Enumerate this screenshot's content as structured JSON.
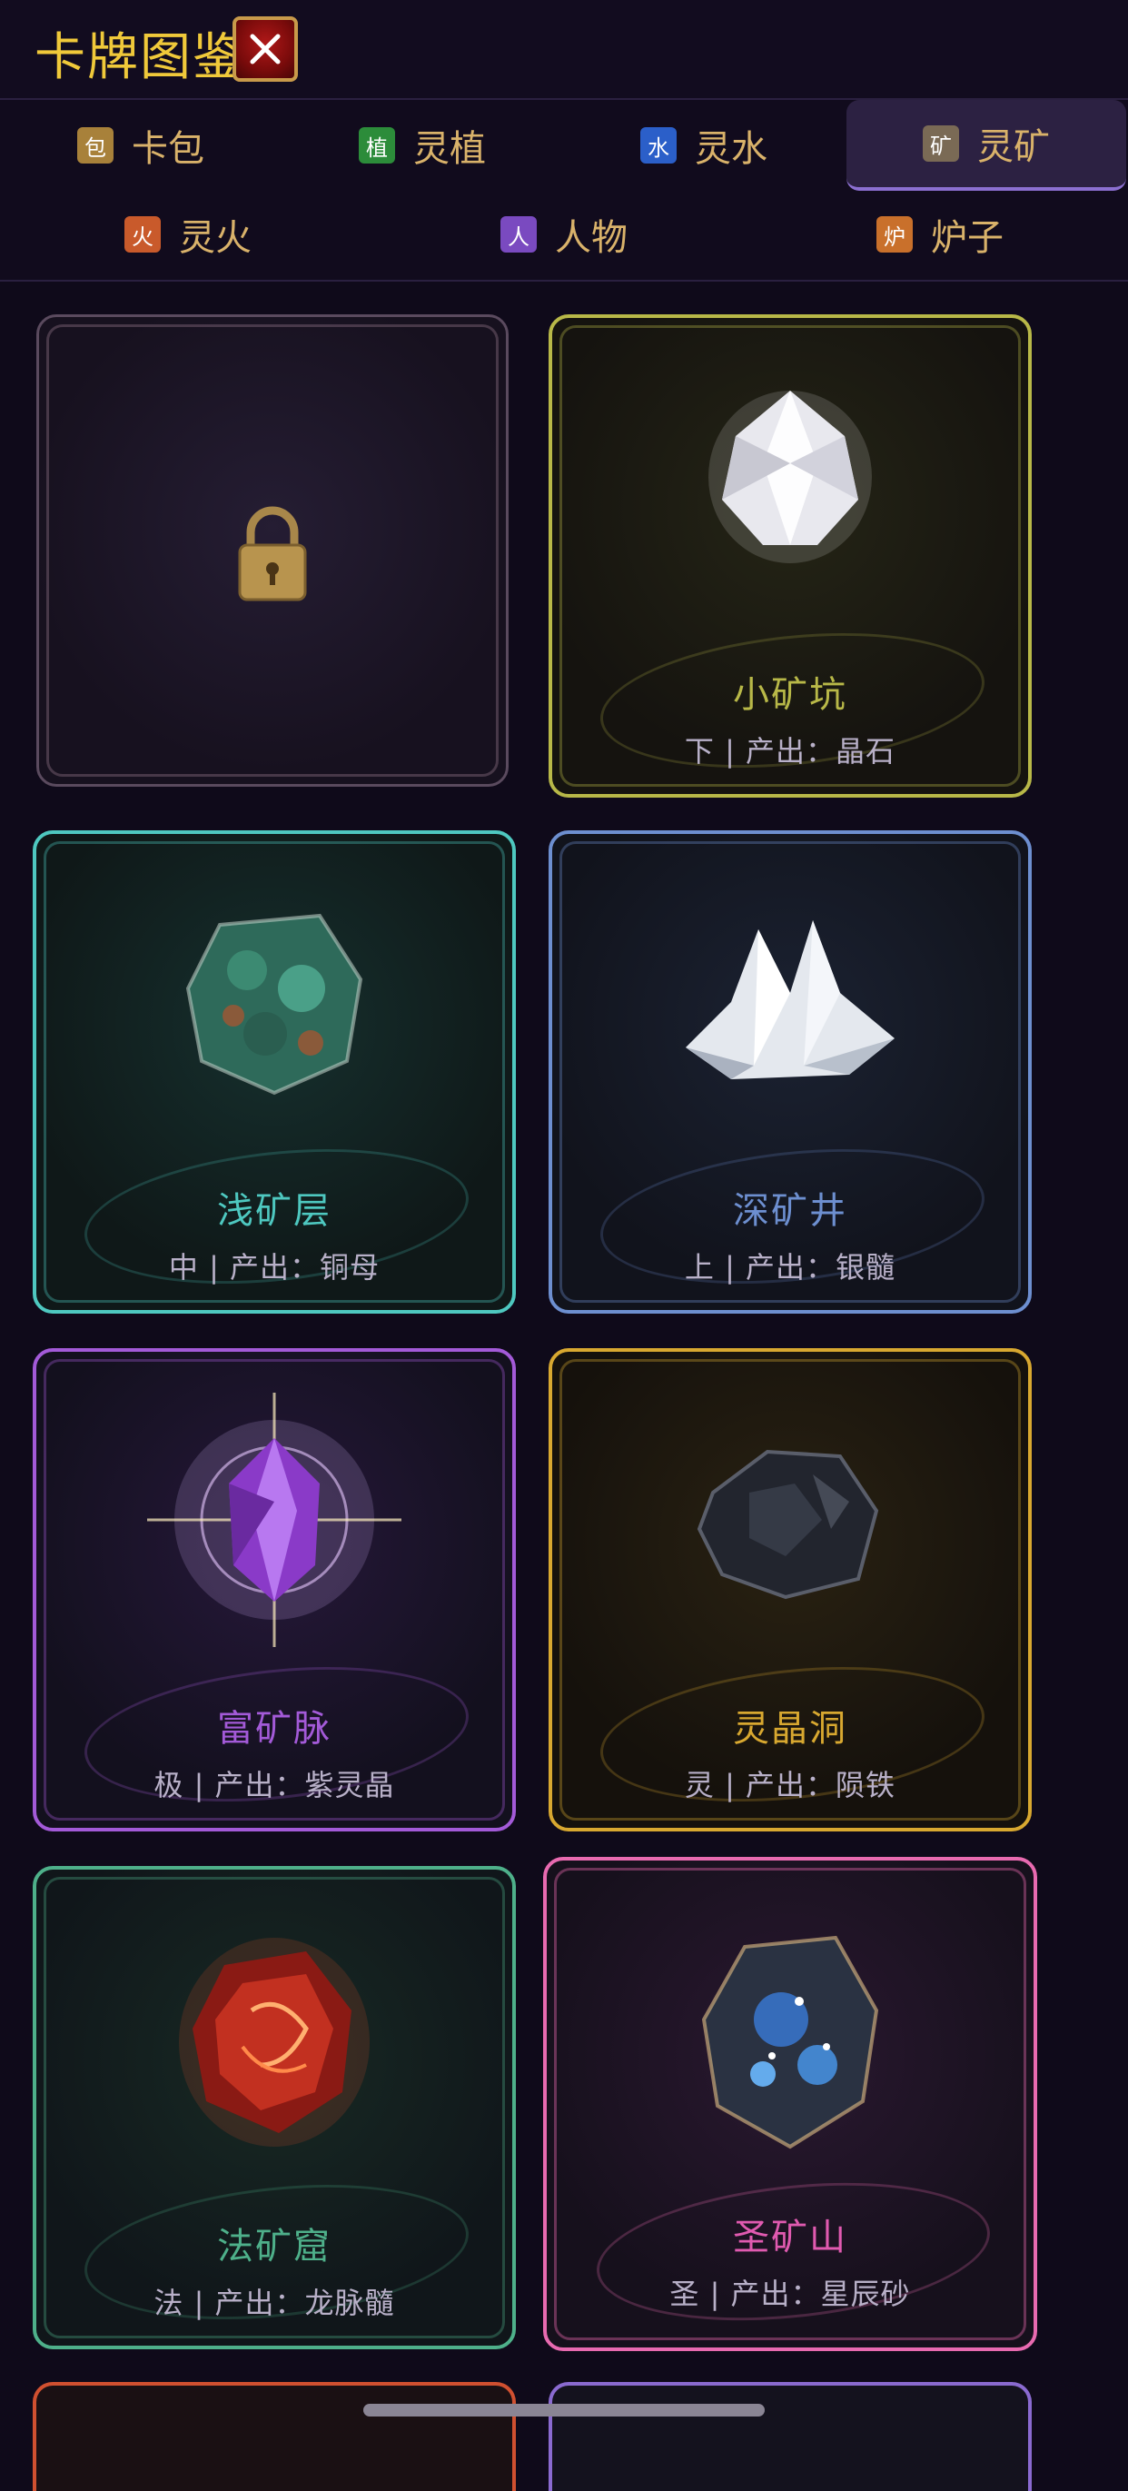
{
  "header": {
    "title": "卡牌图鉴",
    "close_icon": "close-icon"
  },
  "tabs": [
    {
      "icon": "包",
      "label": "卡包",
      "color": "#a8813a"
    },
    {
      "icon": "植",
      "label": "灵植",
      "color": "#2c8c3a"
    },
    {
      "icon": "水",
      "label": "灵水",
      "color": "#2b5fc9"
    },
    {
      "icon": "矿",
      "label": "灵矿",
      "color": "#7a6a55",
      "active": true
    },
    {
      "icon": "火",
      "label": "灵火",
      "color": "#c95a2b"
    },
    {
      "icon": "人",
      "label": "人物",
      "color": "#7a4ac0"
    },
    {
      "icon": "炉",
      "label": "炉子",
      "color": "#c9702b"
    }
  ],
  "cards": [
    {
      "locked": true,
      "lock_icon": "padlock-icon"
    },
    {
      "name": "小矿坑",
      "desc": "下 | 产出：晶石",
      "color": "#b8b848"
    },
    {
      "name": "浅矿层",
      "desc": "中 | 产出：铜母",
      "color": "#4ec8c0"
    },
    {
      "name": "深矿井",
      "desc": "上 | 产出：银髓",
      "color": "#6d8fd0"
    },
    {
      "name": "富矿脉",
      "desc": "极 | 产出：紫灵晶",
      "color": "#a35ad8"
    },
    {
      "name": "灵晶洞",
      "desc": "灵 | 产出：陨铁",
      "color": "#d8a830"
    },
    {
      "name": "法矿窟",
      "desc": "法 | 产出：龙脉髓",
      "color": "#4eb08a"
    },
    {
      "name": "圣矿山",
      "desc": "圣 | 产出：星辰砂",
      "color": "#e05ab0"
    }
  ]
}
